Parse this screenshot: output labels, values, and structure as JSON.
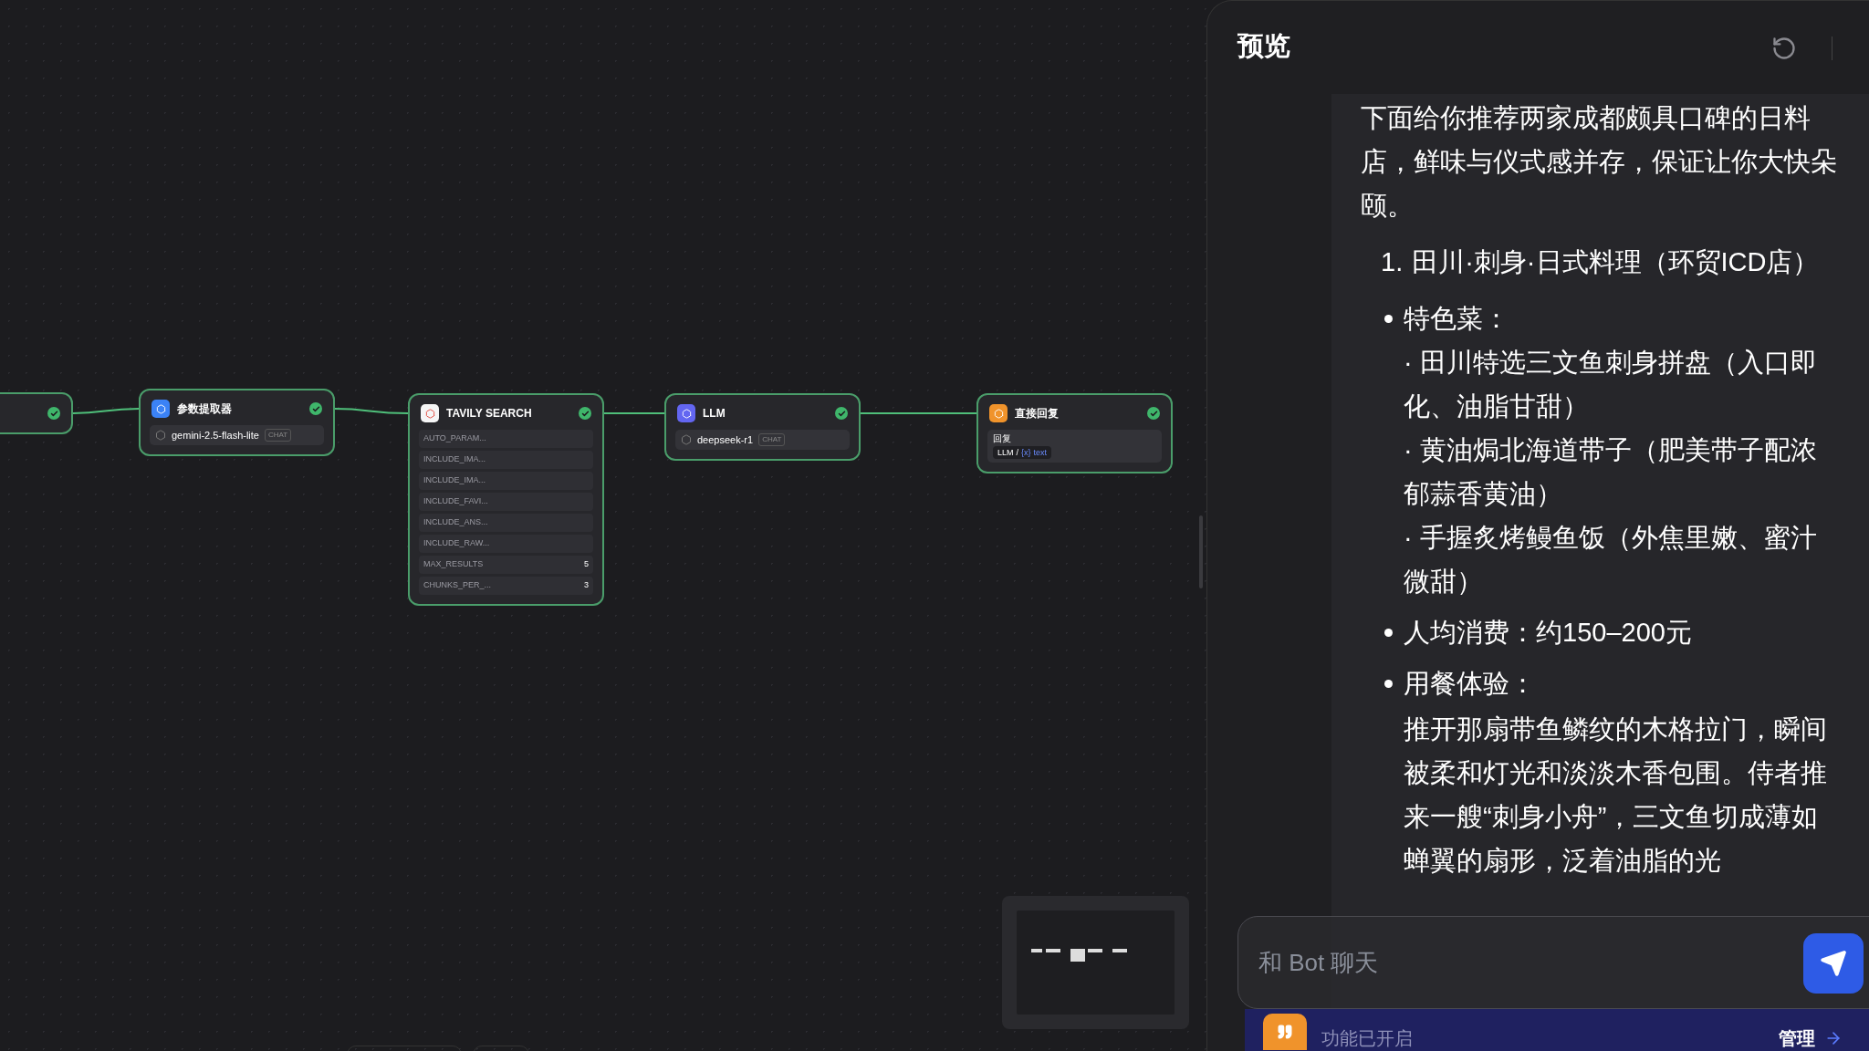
{
  "canvas": {
    "nodes": [
      {
        "kind": "partial",
        "done": true
      },
      {
        "kind": "model",
        "title": "参数提取器",
        "color": "#3b82f6",
        "done": true,
        "model": "gemini-2.5-flash-lite",
        "tag": "CHAT"
      },
      {
        "kind": "params",
        "title": "TAVILY SEARCH",
        "color": "#f5f5f5",
        "done": true,
        "params": [
          {
            "name": "AUTO_PARAM..."
          },
          {
            "name": "INCLUDE_IMA..."
          },
          {
            "name": "INCLUDE_IMA..."
          },
          {
            "name": "INCLUDE_FAVI..."
          },
          {
            "name": "INCLUDE_ANS..."
          },
          {
            "name": "INCLUDE_RAW..."
          },
          {
            "name": "MAX_RESULTS",
            "value": "5"
          },
          {
            "name": "CHUNKS_PER_...",
            "value": "3"
          }
        ]
      },
      {
        "kind": "model",
        "title": "LLM",
        "color": "#6366f1",
        "done": true,
        "model": "deepseek-r1",
        "tag": "CHAT"
      },
      {
        "kind": "reply",
        "title": "直接回复",
        "color": "#f0932b",
        "done": true,
        "label": "回复",
        "source": "LLM",
        "separator": "/",
        "variable_mark": "{x}",
        "variable": "text"
      }
    ]
  },
  "preview": {
    "title": "预览",
    "intro": "下面给你推荐两家成都颇具口碑的日料店，鲜味与仪式感并存，保证让你大快朵颐。",
    "item": {
      "number": "1.",
      "text": "田川·刺身·日式料理（环贸ICD店）"
    },
    "bullets": [
      {
        "label": "特色菜：",
        "lines": [
          "· 田川特选三文鱼刺身拼盘（入口即化、油脂甘甜）",
          "· 黄油焗北海道带子（肥美带子配浓郁蒜香黄油）",
          "· 手握炙烤鳗鱼饭（外焦里嫩、蜜汁微甜）"
        ]
      },
      {
        "label": "人均消费：约150–200元"
      },
      {
        "label": "用餐体验：",
        "paragraph": "推开那扇带鱼鳞纹的木格拉门，瞬间被柔和灯光和淡淡木香包围。侍者推来一艘“刺身小舟”，三文鱼切成薄如蝉翼的扇形，泛着油脂的光"
      }
    ],
    "chat_input": {
      "placeholder": "和 Bot 聊天"
    },
    "feature_bar": {
      "text": "功能已开启",
      "link": "管理"
    }
  }
}
